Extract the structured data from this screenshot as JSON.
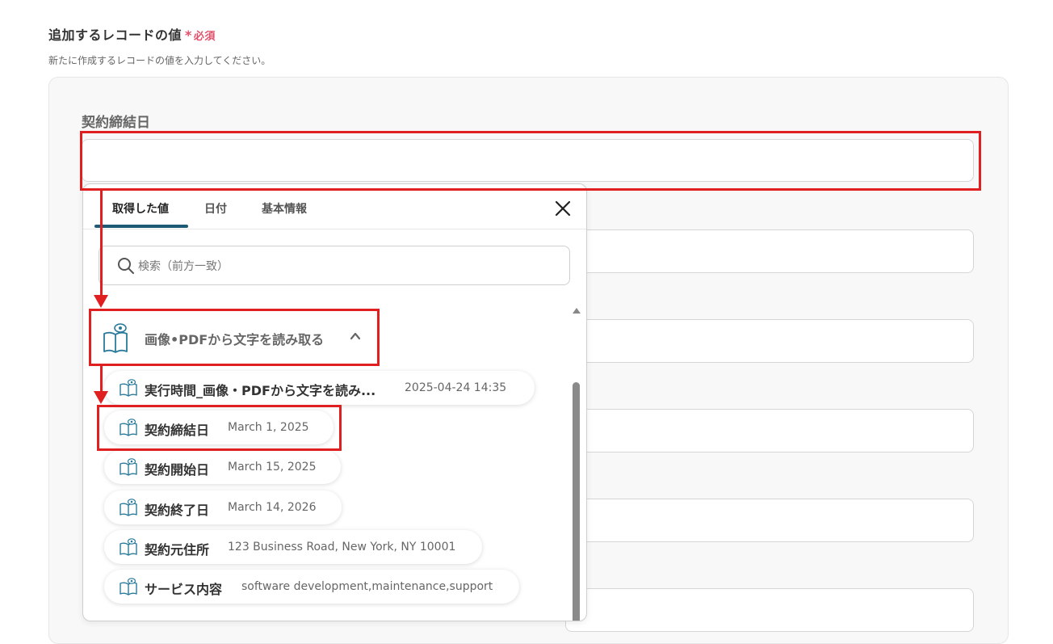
{
  "section": {
    "title": "追加するレコードの値",
    "required_star": "*",
    "required_text": "必須",
    "description": "新たに作成するレコードの値を入力してください。"
  },
  "field": {
    "label": "契約締結日",
    "value": ""
  },
  "popup": {
    "tabs": [
      {
        "label": "取得した値",
        "active": true
      },
      {
        "label": "日付",
        "active": false
      },
      {
        "label": "基本情報",
        "active": false
      }
    ],
    "close_icon": "close-icon",
    "search": {
      "placeholder": "検索（前方一致）",
      "value": ""
    },
    "group": {
      "title": "画像•PDFから文字を読み取る",
      "icon": "book-eye-icon",
      "expanded": true
    },
    "items": [
      {
        "label": "実行時間_画像・PDFから文字を読み...",
        "value": "2025-04-24 14:35"
      },
      {
        "label": "契約締結日",
        "value": "March 1, 2025"
      },
      {
        "label": "契約開始日",
        "value": "March 15, 2025"
      },
      {
        "label": "契約終了日",
        "value": "March 14, 2026"
      },
      {
        "label": "契約元住所",
        "value": "123 Business Road, New York, NY 10001"
      },
      {
        "label": "サービス内容",
        "value": "software development,maintenance,support"
      }
    ]
  },
  "colors": {
    "required": "#e0506a",
    "highlight": "#e02020",
    "tab_active": "#1c5a75",
    "icon": "#2a7a9a"
  }
}
